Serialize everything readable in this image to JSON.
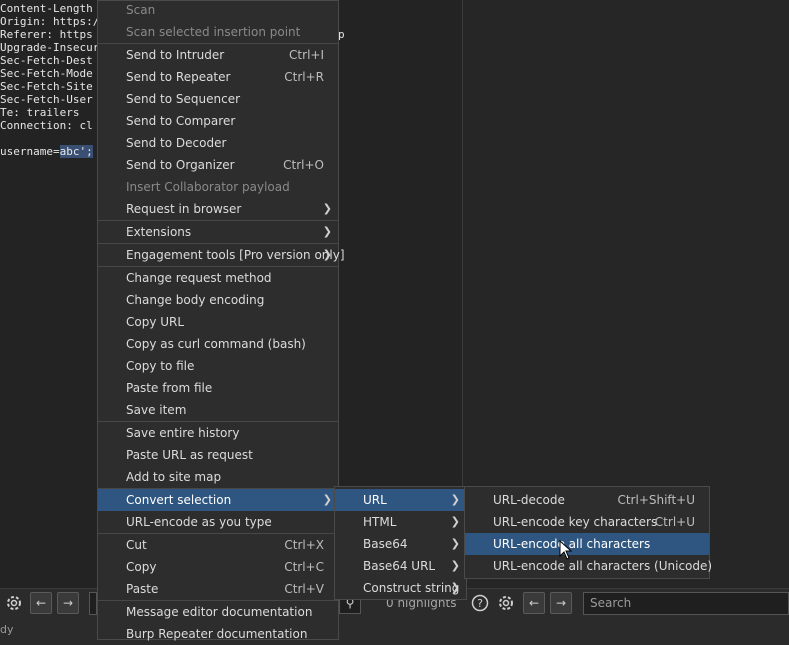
{
  "editor": {
    "lines": [
      "Content-Length",
      "Origin: https:/",
      "Referer: https",
      "Upgrade-Insecur",
      "Sec-Fetch-Dest",
      "Sec-Fetch-Mode",
      "Sec-Fetch-Site",
      "Sec-Fetch-User",
      "Te: trailers",
      "Connection: cl"
    ],
    "body_prefix": "username=",
    "body_selected": "abc';",
    "fragment_right": "p"
  },
  "context_menu": {
    "scan": "Scan",
    "scan_insertion": "Scan selected insertion point",
    "send_intruder": "Send to Intruder",
    "send_intruder_sc": "Ctrl+I",
    "send_repeater": "Send to Repeater",
    "send_repeater_sc": "Ctrl+R",
    "send_sequencer": "Send to Sequencer",
    "send_comparer": "Send to Comparer",
    "send_decoder": "Send to Decoder",
    "send_organizer": "Send to Organizer",
    "send_organizer_sc": "Ctrl+O",
    "insert_collab": "Insert Collaborator payload",
    "request_browser": "Request in browser",
    "extensions": "Extensions",
    "engagement": "Engagement tools [Pro version only]",
    "change_method": "Change request method",
    "change_body": "Change body encoding",
    "copy_url": "Copy URL",
    "copy_curl": "Copy as curl command (bash)",
    "copy_file": "Copy to file",
    "paste_file": "Paste from file",
    "save_item": "Save item",
    "save_history": "Save entire history",
    "paste_url": "Paste URL as request",
    "add_sitemap": "Add to site map",
    "convert_selection": "Convert selection",
    "url_encode_type": "URL-encode as you type",
    "cut": "Cut",
    "cut_sc": "Ctrl+X",
    "copy": "Copy",
    "copy_sc": "Ctrl+C",
    "paste": "Paste",
    "paste_sc": "Ctrl+V",
    "msg_doc": "Message editor documentation",
    "burp_doc": "Burp Repeater documentation"
  },
  "convert_menu": {
    "url": "URL",
    "html": "HTML",
    "base64": "Base64",
    "base64url": "Base64 URL",
    "construct": "Construct string"
  },
  "url_menu": {
    "decode": "URL-decode",
    "decode_sc": "Ctrl+Shift+U",
    "encode_key": "URL-encode key characters",
    "encode_key_sc": "Ctrl+U",
    "encode_all": "URL-encode all characters",
    "encode_unicode": "URL-encode all characters (Unicode)"
  },
  "bottom": {
    "highlights": "0 highlights",
    "search_placeholder": "Search",
    "status_left": "dy"
  },
  "colors": {
    "selection": "#2f5680",
    "menu_bg": "#2d2d2d",
    "editor_bg": "#232323"
  }
}
